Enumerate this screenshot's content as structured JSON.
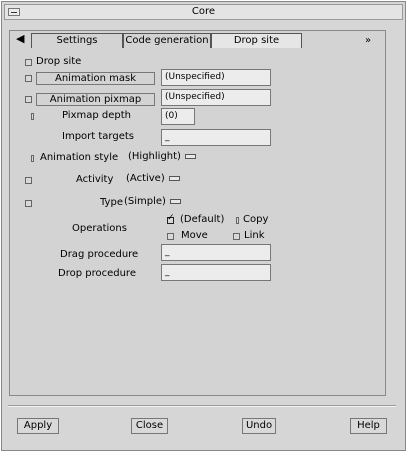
{
  "window": {
    "title": "Core"
  },
  "tabs": [
    {
      "label": "Settings"
    },
    {
      "label": "Code generation"
    },
    {
      "label": "Drop site"
    }
  ],
  "drop_site": {
    "label": "Drop site"
  },
  "animation_mask": {
    "label": "Animation mask",
    "value": "(Unspecified)"
  },
  "animation_pixmap": {
    "label": "Animation pixmap",
    "value": "(Unspecified)"
  },
  "pixmap_depth": {
    "label": "Pixmap depth",
    "value": "(0)"
  },
  "import_targets": {
    "label": "Import targets",
    "value": "_"
  },
  "animation_style": {
    "label": "Animation style",
    "value": "(Highlight)"
  },
  "activity": {
    "label": "Activity",
    "value": "(Active)"
  },
  "type": {
    "label": "Type",
    "value": "(Simple)"
  },
  "operations": {
    "label": "Operations",
    "default": "(Default)",
    "copy": "Copy",
    "move": "Move",
    "link": "Link"
  },
  "drag_procedure": {
    "label": "Drag procedure",
    "value": "_"
  },
  "drop_procedure": {
    "label": "Drop procedure",
    "value": "_"
  },
  "buttons": {
    "apply": "Apply",
    "close": "Close",
    "undo": "Undo",
    "help": "Help"
  },
  "icons": {
    "left": "left-arrow-icon",
    "right": "right-arrow-icon",
    "menu": "window-menu-icon"
  }
}
